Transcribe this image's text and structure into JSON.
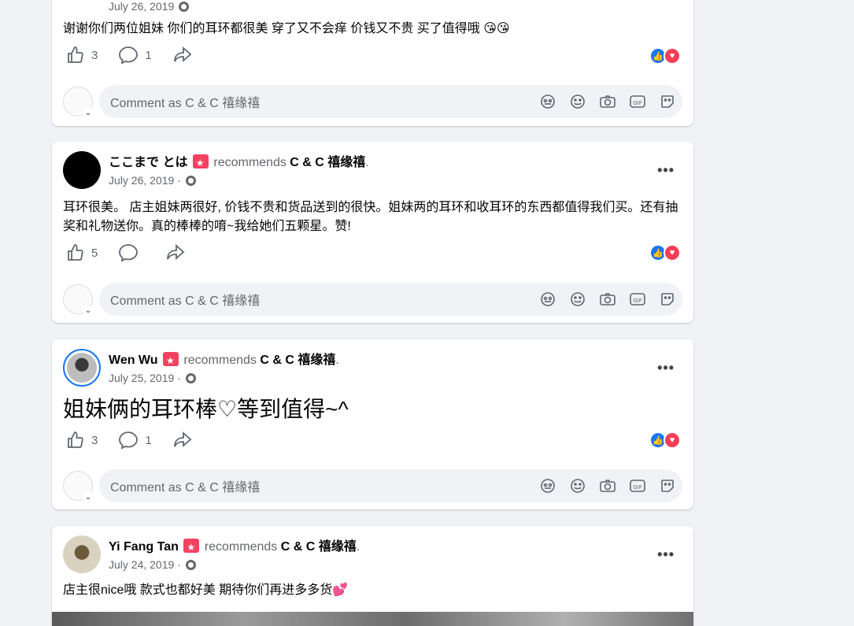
{
  "comment_placeholder": "Comment as C & C 禧缘禧",
  "posts": [
    {
      "date": "July 26, 2019",
      "text": "谢谢你们两位姐妹  你们的耳环都很美 穿了又不会痒  价钱又不贵  买了值得哦 😘😘",
      "likes": "3",
      "comments": "1"
    },
    {
      "author": "ここまで とは",
      "recommends": "recommends",
      "page": "C & C 禧缘禧",
      "date": "July 26, 2019",
      "text": "耳环很美。 店主姐妹两很好, 价钱不贵和货品送到的很快。姐妹两的耳环和收耳环的东西都值得我们买。还有抽奖和礼物送你。真的棒棒的唷~我给她们五颗星。赞!",
      "likes": "5"
    },
    {
      "author": "Wen Wu",
      "recommends": "recommends",
      "page": "C & C 禧缘禧",
      "date": "July 25, 2019",
      "text": "姐妹俩的耳环棒♡等到值得~^",
      "likes": "3",
      "comments": "1"
    },
    {
      "author": "Yi Fang Tan",
      "recommends": "recommends",
      "page": "C & C 禧缘禧",
      "date": "July 24, 2019",
      "text": "店主很nice哦 款式也都好美 期待你们再进多多货💕"
    }
  ],
  "colors": {
    "like": "#1877f2",
    "love": "#f33e58",
    "recommend": "#f3425f",
    "background": "#f0f2f5"
  }
}
